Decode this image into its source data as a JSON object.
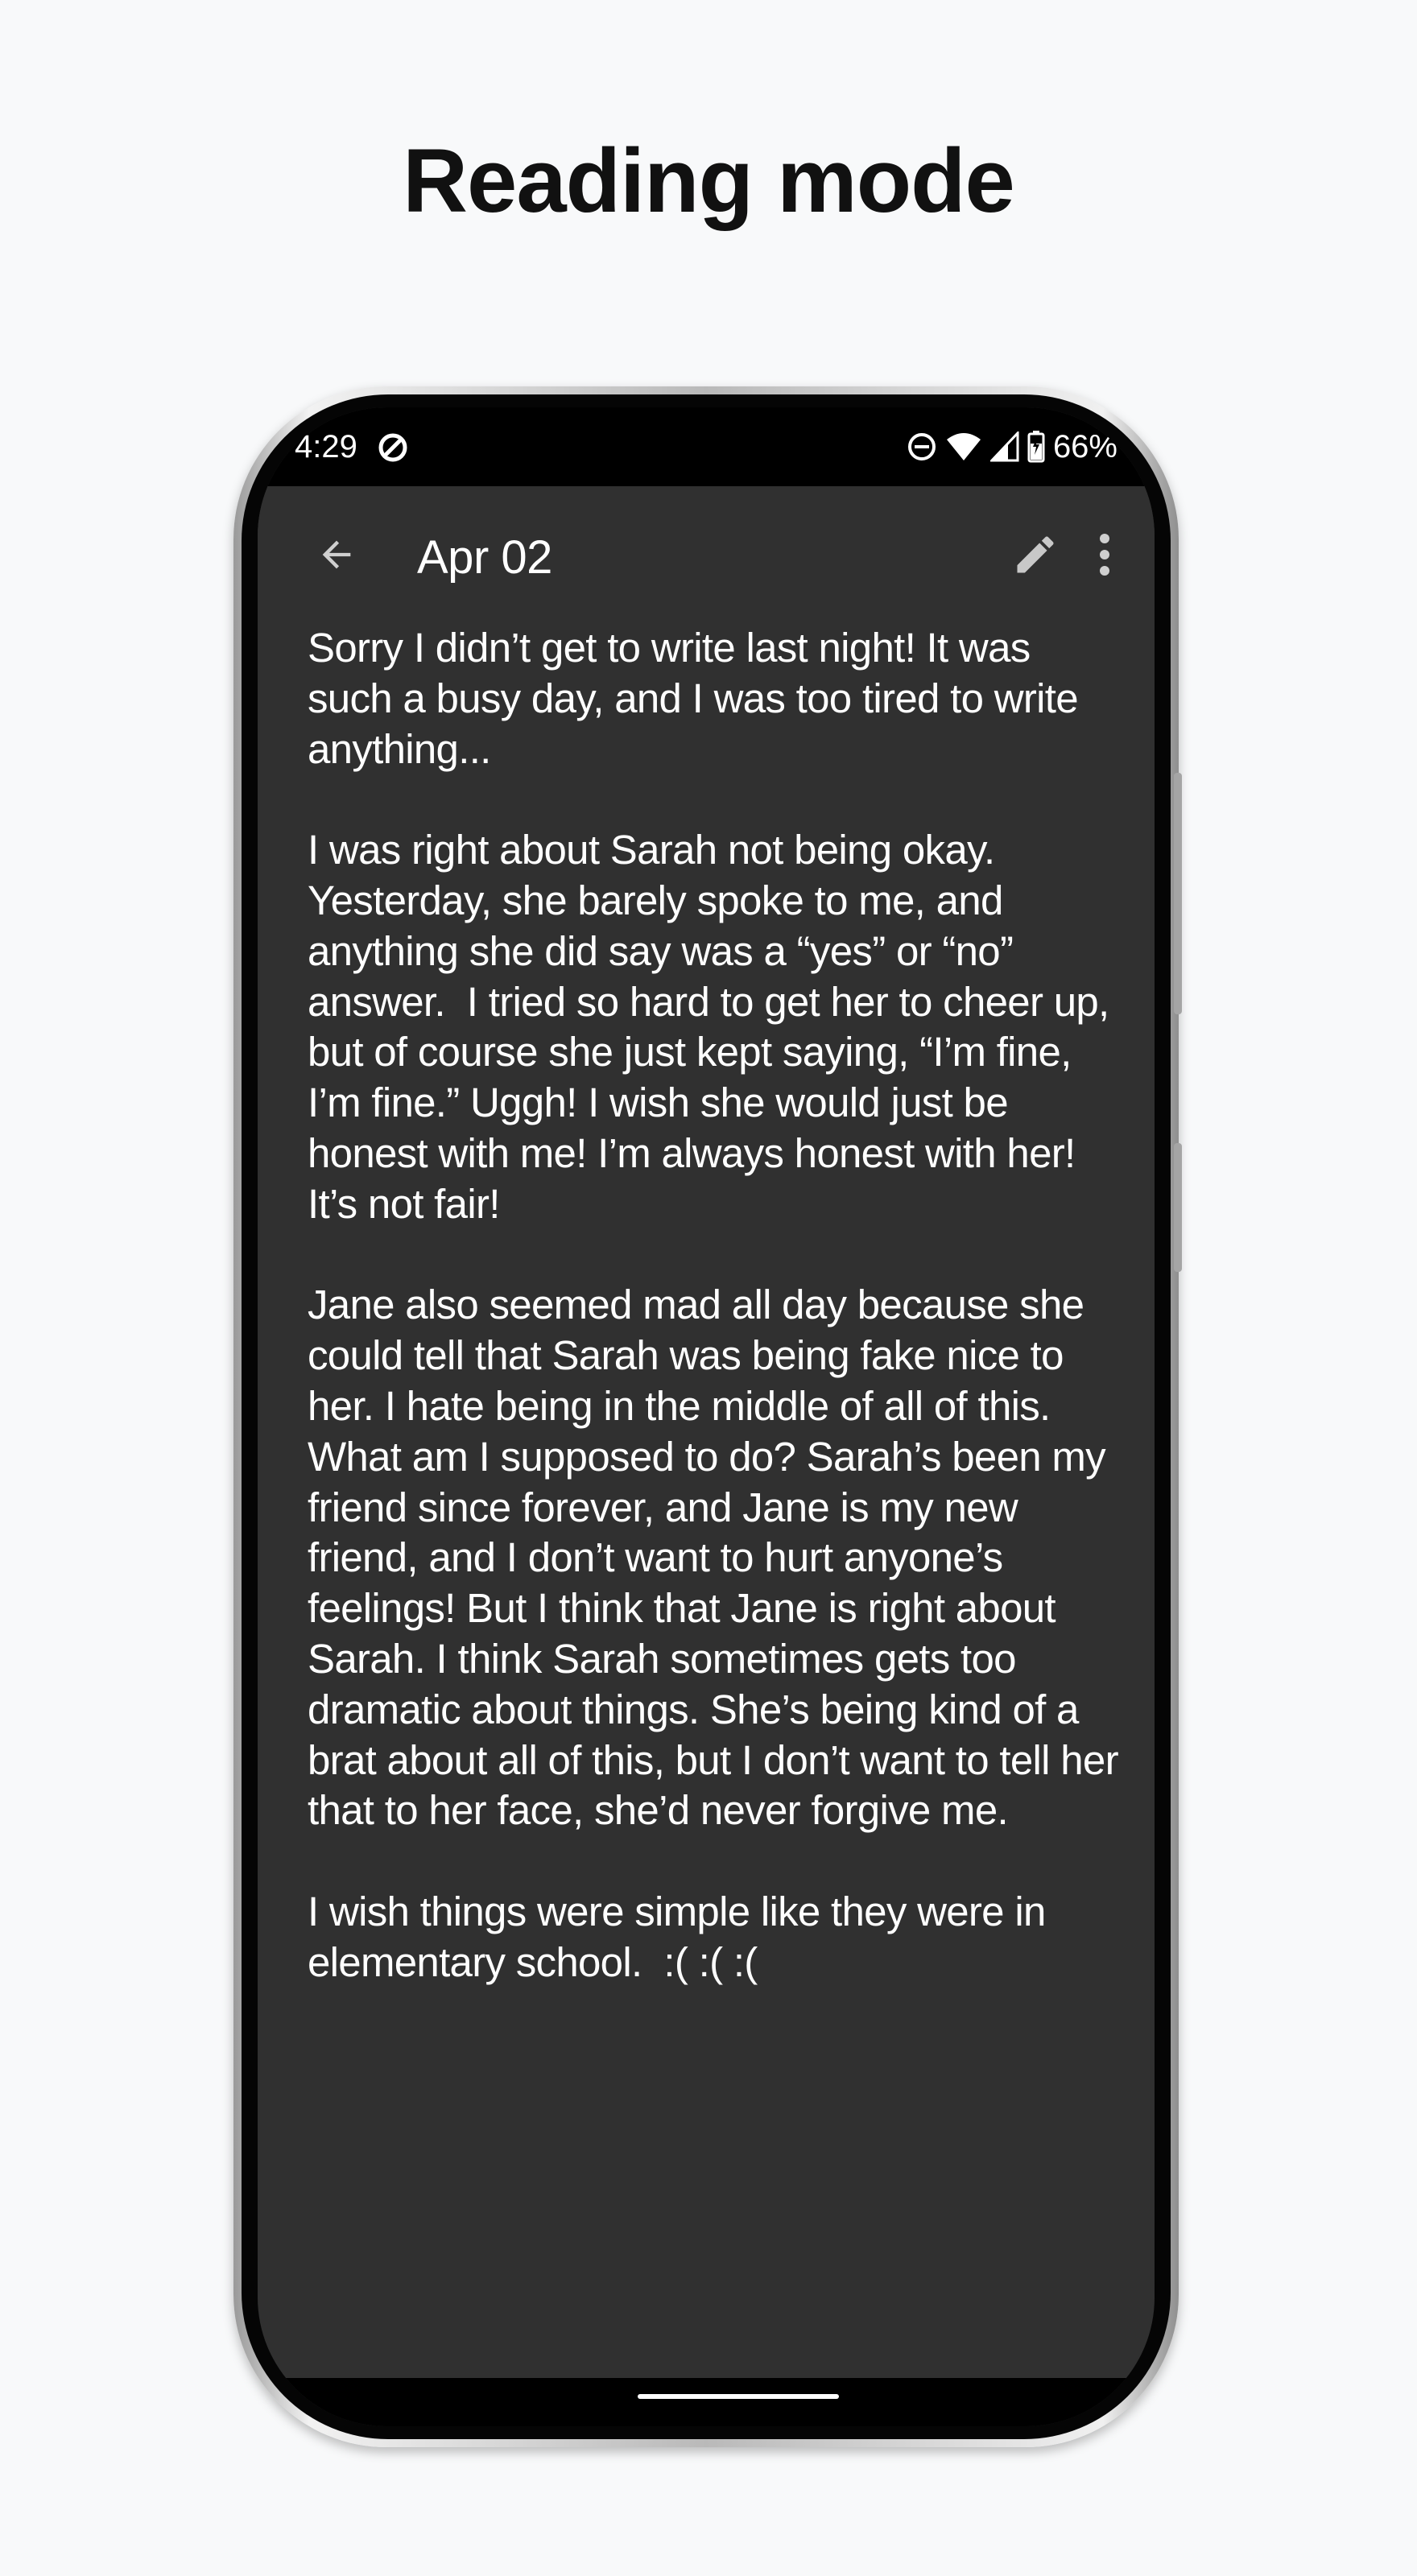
{
  "promo": {
    "title": "Reading mode"
  },
  "status_bar": {
    "time": "4:29",
    "battery": "66%",
    "icons": [
      "sync-icon",
      "do-not-disturb-icon",
      "wifi-icon",
      "cell-signal-icon",
      "battery-icon"
    ]
  },
  "app_bar": {
    "back_icon": "arrow-back-icon",
    "title": "Apr 02",
    "edit_icon": "pencil-icon",
    "menu_icon": "more-vert-icon"
  },
  "entry": {
    "paragraphs": [
      "Sorry I didn’t get to write last night! It was such a busy day, and I was too tired to write anything...",
      "I was right about Sarah not being okay. Yesterday, she barely spoke to me, and anything she did say was a “yes” or “no” answer.  I tried so hard to get her to cheer up, but of course she just kept saying, “I’m fine, I’m fine.” Uggh! I wish she would just be honest with me! I’m always honest with her! It’s not fair!",
      "Jane also seemed mad all day because she could tell that Sarah was being fake nice to her. I hate being in the middle of all of this. What am I supposed to do? Sarah’s been my friend since forever, and Jane is my new friend, and I don’t want to hurt anyone’s feelings! But I think that Jane is right about Sarah. I think Sarah sometimes gets too dramatic about things. She’s being kind of a brat about all of this, but I don’t want to tell her that to her face, she’d never forgive me.",
      "I wish things were simple like they were in elementary school.  :( :( :("
    ]
  },
  "colors": {
    "page_background": "#f8f9fa",
    "screen_background": "#303030",
    "status_bar": "#000000",
    "text": "#ffffff",
    "icon": "#cfcfcf"
  }
}
